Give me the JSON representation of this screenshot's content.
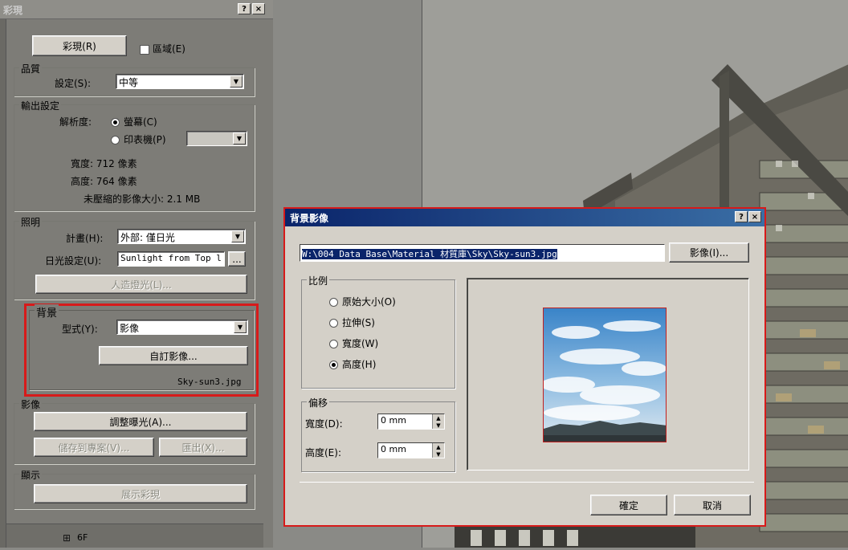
{
  "panel": {
    "title": "彩現",
    "help": "?",
    "close": "×",
    "render_button": "彩現(R)",
    "region_checkbox": "區域(E)",
    "quality": {
      "group": "品質",
      "setting_label": "設定(S):",
      "setting_value": "中等"
    },
    "output": {
      "group": "輸出設定",
      "resolution_label": "解析度:",
      "screen_option": "螢幕(C)",
      "printer_option": "印表機(P)",
      "width_text": "寬度: 712 像素",
      "height_text": "高度: 764 像素",
      "size_text": "未壓縮的影像大小: 2.1 MB"
    },
    "lighting": {
      "group": "照明",
      "plan_label": "計畫(H):",
      "plan_value": "外部: 僅日光",
      "sun_label": "日光設定(U):",
      "sun_value": "Sunlight from Top l",
      "sun_button": "...",
      "artificial_button": "人造燈光(L)..."
    },
    "background": {
      "group": "背景",
      "type_label": "型式(Y):",
      "type_value": "影像",
      "custom_button": "自訂影像...",
      "file_name": "Sky-sun3.jpg"
    },
    "image": {
      "group": "影像",
      "exposure_button": "調整曝光(A)...",
      "save_button": "儲存到專案(V)...",
      "export_button": "匯出(X)..."
    },
    "display": {
      "group": "顯示",
      "show_button": "展示彩現"
    },
    "tree_item": "6F"
  },
  "dialog": {
    "title": "背景影像",
    "help": "?",
    "close": "×",
    "path": "W:\\004 Data Base\\Material 材質庫\\Sky\\Sky-sun3.jpg",
    "image_button": "影像(I)...",
    "scale_group": "比例",
    "scale_options": [
      "原始大小(O)",
      "拉伸(S)",
      "寬度(W)",
      "高度(H)"
    ],
    "scale_selected": 3,
    "offset_group": "偏移",
    "offset_width_label": "寬度(D):",
    "offset_width_value": "0 mm",
    "offset_height_label": "高度(E):",
    "offset_height_value": "0 mm",
    "ok_button": "確定",
    "cancel_button": "取消"
  }
}
